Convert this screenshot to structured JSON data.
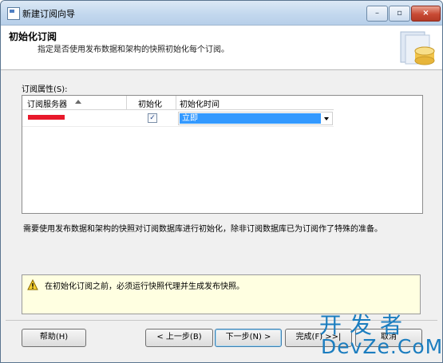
{
  "window": {
    "title": "新建订阅向导"
  },
  "titlebar_buttons": {
    "minimize": "–",
    "maximize": "▫",
    "close": "×"
  },
  "header": {
    "title": "初始化订阅",
    "subtitle": "指定是否使用发布数据和架构的快照初始化每个订阅。"
  },
  "grid": {
    "label": "订阅属性(S):",
    "columns": [
      "订阅服务器",
      "初始化",
      "初始化时间"
    ],
    "sort": "ascending",
    "rows": [
      {
        "subscriber": "(redacted)",
        "initialize": true,
        "init_time": "立即"
      }
    ]
  },
  "description": "需要使用发布数据和架构的快照对订阅数据库进行初始化，除非订阅数据库已为订阅作了特殊的准备。",
  "warning": {
    "icon": "warning-icon",
    "text": "在初始化订阅之前，必须运行快照代理并生成发布快照。"
  },
  "buttons": {
    "help": "帮助(H)",
    "back": "< 上一步(B)",
    "next": "下一步(N) >",
    "finish": "完成(F) >>|",
    "cancel": "取消"
  },
  "watermark": {
    "top": "开发者",
    "bottom": "DevZe.CoM"
  },
  "colors": {
    "selection": "#3399ff",
    "warning_bg": "#ffffe1",
    "watermark": "#1b7dbf",
    "redaction": "#e8192b"
  }
}
